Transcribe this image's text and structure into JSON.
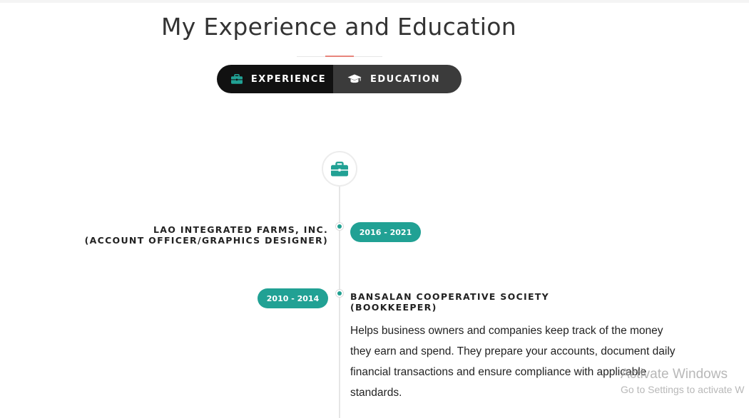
{
  "section": {
    "title": "My Experience and Education"
  },
  "toggle": {
    "experience_label": "EXPERIENCE",
    "education_label": "EDUCATION",
    "active": "experience"
  },
  "timeline": {
    "entries": [
      {
        "company": "LAO INTEGRATED FARMS, INC.",
        "role": "(ACCOUNT OFFICER/GRAPHICS DESIGNER)",
        "years": "2016 - 2021",
        "side": "left"
      },
      {
        "company": "BANSALAN COOPERATIVE SOCIETY",
        "role": "(BOOKKEEPER)",
        "years": "2010 - 2014",
        "side": "right",
        "description": "Helps business owners and companies keep track of the money they earn and spend. They prepare your accounts, document daily financial transactions and ensure compliance with applicable standards."
      }
    ]
  },
  "watermark": {
    "line1": "Activate Windows",
    "line2": "Go to Settings to activate W"
  },
  "colors": {
    "accent": "#21a194",
    "underline_accent": "#e8857c",
    "toggle_active": "#111111",
    "toggle_inactive": "#3b3b3b"
  },
  "icons": {
    "experience": "briefcase-icon",
    "education": "graduation-cap-icon"
  }
}
